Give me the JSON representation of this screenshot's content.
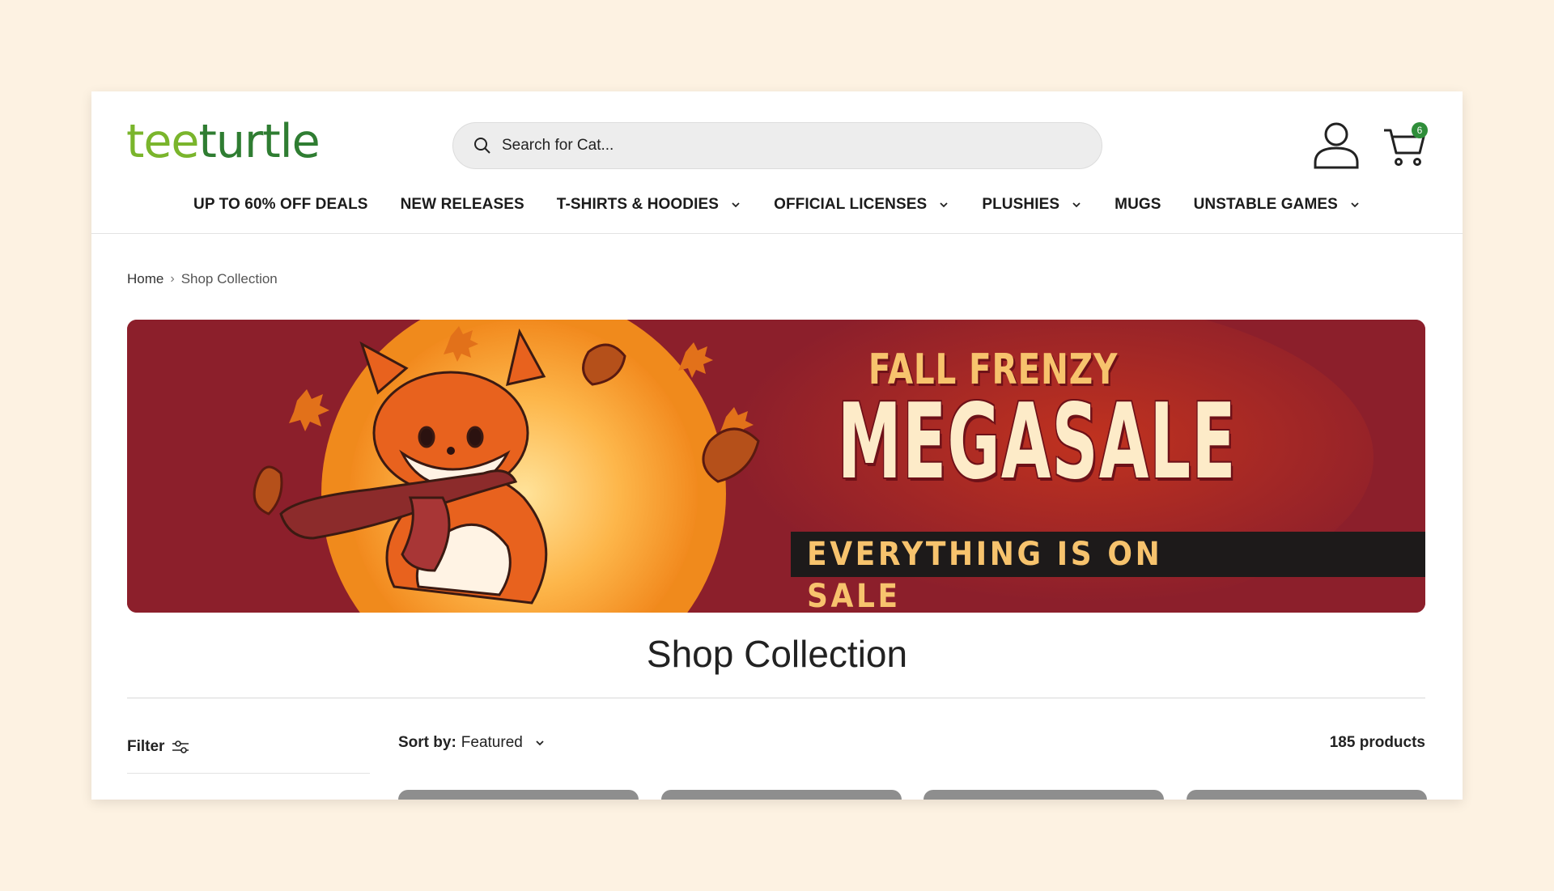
{
  "header": {
    "logo_part1": "tee",
    "logo_part2": "turtle",
    "search_placeholder": "Search for Cat...",
    "cart_count": "6"
  },
  "nav": {
    "items": [
      {
        "label": "UP TO 60% OFF DEALS",
        "has_dropdown": false
      },
      {
        "label": "NEW RELEASES",
        "has_dropdown": false
      },
      {
        "label": "T-SHIRTS & HOODIES",
        "has_dropdown": true
      },
      {
        "label": "OFFICIAL LICENSES",
        "has_dropdown": true
      },
      {
        "label": "PLUSHIES",
        "has_dropdown": true
      },
      {
        "label": "MUGS",
        "has_dropdown": false
      },
      {
        "label": "UNSTABLE GAMES",
        "has_dropdown": true
      }
    ]
  },
  "breadcrumb": {
    "home": "Home",
    "current": "Shop Collection"
  },
  "banner": {
    "line1": "FALL FRENZY",
    "line2": "MEGASALE",
    "line3": "EVERYTHING IS ON SALE"
  },
  "main": {
    "title": "Shop Collection",
    "filter_label": "Filter",
    "sort_label": "Sort by:",
    "sort_value": "Featured",
    "product_count": "185 products"
  },
  "colors": {
    "background": "#fdf2e2",
    "logo_light": "#7ab52c",
    "logo_dark": "#2f7d32",
    "banner_red": "#8c1f2b",
    "cart_badge": "#2f8e3a"
  }
}
